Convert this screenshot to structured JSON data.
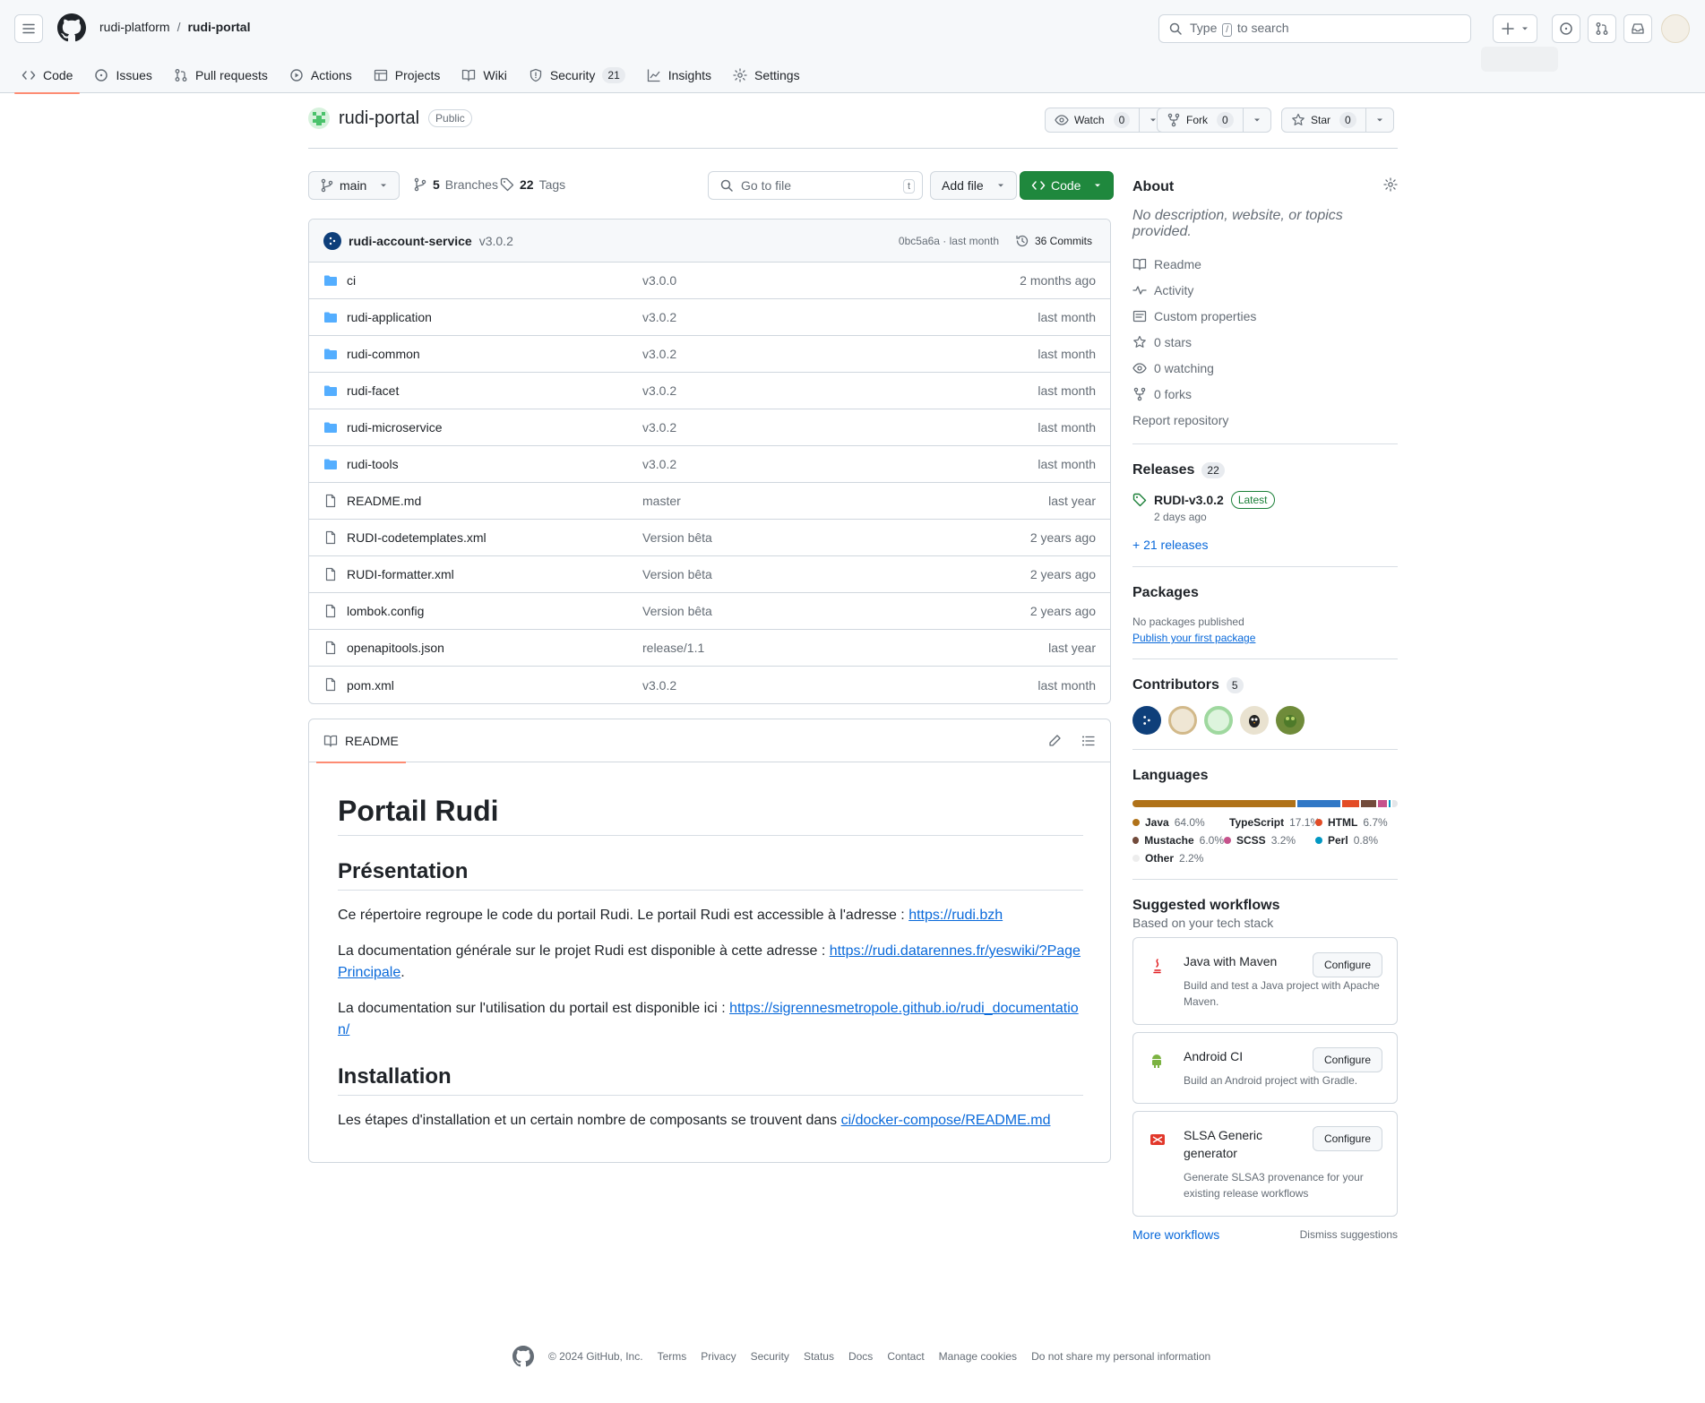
{
  "header": {
    "owner": "rudi-platform",
    "separator": "/",
    "repo": "rudi-portal",
    "search_prefix": "Type",
    "search_key": "/",
    "search_suffix": "to search"
  },
  "nav": [
    {
      "label": "Code",
      "icon": "code-icon",
      "active": true
    },
    {
      "label": "Issues",
      "icon": "issue-icon"
    },
    {
      "label": "Pull requests",
      "icon": "pull-request-icon"
    },
    {
      "label": "Actions",
      "icon": "play-icon"
    },
    {
      "label": "Projects",
      "icon": "table-icon"
    },
    {
      "label": "Wiki",
      "icon": "book-icon"
    },
    {
      "label": "Security",
      "icon": "shield-icon",
      "count": "21"
    },
    {
      "label": "Insights",
      "icon": "graph-icon"
    },
    {
      "label": "Settings",
      "icon": "gear-icon"
    }
  ],
  "repo": {
    "name": "rudi-portal",
    "visibility": "Public",
    "watch_label": "Watch",
    "watch_count": "0",
    "fork_label": "Fork",
    "fork_count": "0",
    "star_label": "Star",
    "star_count": "0"
  },
  "toolbar": {
    "branch": "main",
    "branches_count": "5",
    "branches_label": "Branches",
    "tags_count": "22",
    "tags_label": "Tags",
    "goto_placeholder": "Go to file",
    "goto_key": "t",
    "add_file": "Add file",
    "code": "Code"
  },
  "commit": {
    "author": "rudi-account-service",
    "message": "v3.0.2",
    "meta": "0bc5a6a · last month",
    "count": "36 Commits"
  },
  "files": [
    {
      "type": "dir",
      "name": "ci",
      "message": "v3.0.0",
      "date": "2 months ago"
    },
    {
      "type": "dir",
      "name": "rudi-application",
      "message": "v3.0.2",
      "date": "last month"
    },
    {
      "type": "dir",
      "name": "rudi-common",
      "message": "v3.0.2",
      "date": "last month"
    },
    {
      "type": "dir",
      "name": "rudi-facet",
      "message": "v3.0.2",
      "date": "last month"
    },
    {
      "type": "dir",
      "name": "rudi-microservice",
      "message": "v3.0.2",
      "date": "last month"
    },
    {
      "type": "dir",
      "name": "rudi-tools",
      "message": "v3.0.2",
      "date": "last month"
    },
    {
      "type": "file",
      "name": "README.md",
      "message": "master",
      "date": "last year"
    },
    {
      "type": "file",
      "name": "RUDI-codetemplates.xml",
      "message": "Version bêta",
      "date": "2 years ago"
    },
    {
      "type": "file",
      "name": "RUDI-formatter.xml",
      "message": "Version bêta",
      "date": "2 years ago"
    },
    {
      "type": "file",
      "name": "lombok.config",
      "message": "Version bêta",
      "date": "2 years ago"
    },
    {
      "type": "file",
      "name": "openapitools.json",
      "message": "release/1.1",
      "date": "last year"
    },
    {
      "type": "file",
      "name": "pom.xml",
      "message": "v3.0.2",
      "date": "last month"
    }
  ],
  "readme": {
    "tab": "README",
    "h1": "Portail Rudi",
    "h2_presentation": "Présentation",
    "p1_text": "Ce répertoire regroupe le code du portail Rudi. Le portail Rudi est accessible à l'adresse : ",
    "p1_link": "https://rudi.bzh",
    "p2_text": "La documentation générale sur le projet Rudi est disponible à cette adresse : ",
    "p2_link": "https://rudi.datarennes.fr/yeswiki/?PagePrincipale",
    "p2_end": ".",
    "p3_text": "La documentation sur l'utilisation du portail est disponible ici : ",
    "p3_link": "https://sigrennesmetropole.github.io/rudi_documentation/",
    "h2_installation": "Installation",
    "p4_text": "Les étapes d'installation et un certain nombre de composants se trouvent dans ",
    "p4_link": "ci/docker-compose/README.md"
  },
  "about": {
    "title": "About",
    "description": "No description, website, or topics provided.",
    "items": [
      {
        "label": "Readme",
        "icon": "book-icon"
      },
      {
        "label": "Activity",
        "icon": "pulse-icon"
      },
      {
        "label": "Custom properties",
        "icon": "note-icon"
      },
      {
        "label": "0 stars",
        "icon": "star-icon"
      },
      {
        "label": "0 watching",
        "icon": "eye-icon"
      },
      {
        "label": "0 forks",
        "icon": "fork-icon"
      }
    ],
    "report": "Report repository"
  },
  "releases": {
    "title": "Releases",
    "count": "22",
    "latest_name": "RUDI-v3.0.2",
    "latest_badge": "Latest",
    "latest_date": "2 days ago",
    "more": "+ 21 releases"
  },
  "packages": {
    "title": "Packages",
    "none": "No packages published",
    "publish": "Publish your first package"
  },
  "contributors": {
    "title": "Contributors",
    "count": "5"
  },
  "languages": {
    "title": "Languages",
    "items": [
      {
        "name": "Java",
        "pct": "64.0%",
        "value": 64.0,
        "color": "#b07219"
      },
      {
        "name": "TypeScript",
        "pct": "17.1%",
        "value": 17.1,
        "color": "#3178c6"
      },
      {
        "name": "HTML",
        "pct": "6.7%",
        "value": 6.7,
        "color": "#e34c26"
      },
      {
        "name": "Mustache",
        "pct": "6.0%",
        "value": 6.0,
        "color": "#724b3b"
      },
      {
        "name": "SCSS",
        "pct": "3.2%",
        "value": 3.2,
        "color": "#c6538c"
      },
      {
        "name": "Perl",
        "pct": "0.8%",
        "value": 0.8,
        "color": "#0298c3"
      },
      {
        "name": "Other",
        "pct": "2.2%",
        "value": 2.2,
        "color": "#ededed"
      }
    ]
  },
  "workflows": {
    "title": "Suggested workflows",
    "subtitle": "Based on your tech stack",
    "items": [
      {
        "name": "Java with Maven",
        "desc": "Build and test a Java project with Apache Maven.",
        "cta": "Configure"
      },
      {
        "name": "Android CI",
        "desc": "Build an Android project with Gradle.",
        "cta": "Configure"
      },
      {
        "name": "SLSA Generic generator",
        "desc": "Generate SLSA3 provenance for your existing release workflows",
        "cta": "Configure"
      }
    ],
    "more": "More workflows",
    "dismiss": "Dismiss suggestions"
  },
  "footer": {
    "copyright": "© 2024 GitHub, Inc.",
    "links": [
      "Terms",
      "Privacy",
      "Security",
      "Status",
      "Docs",
      "Contact",
      "Manage cookies",
      "Do not share my personal information"
    ]
  },
  "colors": {
    "accent": "#0969da",
    "primary_button": "#1f883d",
    "folder": "#54aeff",
    "tab_underline": "#fd8c73"
  }
}
